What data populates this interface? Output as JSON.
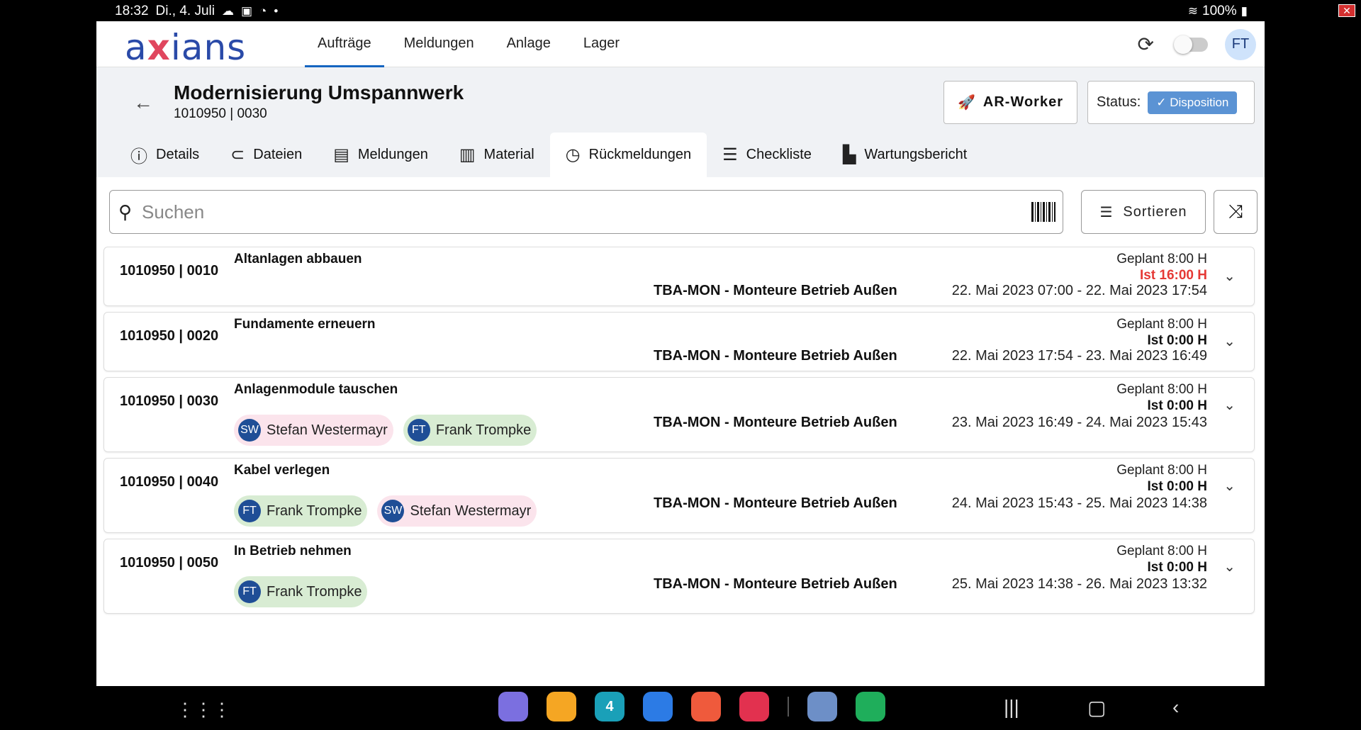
{
  "statusbar": {
    "time": "18:32",
    "date": "Di., 4. Juli",
    "battery": "100%"
  },
  "topbar": {
    "logo_prefix": "a",
    "logo_x": "x",
    "logo_suffix": "ians",
    "nav": [
      "Aufträge",
      "Meldungen",
      "Anlage",
      "Lager"
    ],
    "avatar": "FT"
  },
  "header": {
    "title": "Modernisierung Umspannwerk",
    "subtitle": "1010950 | 0030",
    "ar_button": "AR-Worker",
    "status_label": "Status:",
    "status_value": "Disposition"
  },
  "tabs": [
    {
      "label": "Details",
      "icon": "info-icon"
    },
    {
      "label": "Dateien",
      "icon": "paperclip-icon"
    },
    {
      "label": "Meldungen",
      "icon": "message-icon"
    },
    {
      "label": "Material",
      "icon": "factory-icon"
    },
    {
      "label": "Rückmeldungen",
      "icon": "clock-icon"
    },
    {
      "label": "Checkliste",
      "icon": "checklist-icon"
    },
    {
      "label": "Wartungsbericht",
      "icon": "document-icon"
    }
  ],
  "search": {
    "placeholder": "Suchen",
    "sort_label": "Sortieren"
  },
  "rows": [
    {
      "num": "1010950 | 0010",
      "name": "Altanlagen abbauen",
      "team": "TBA-MON - Monteure Betrieb Außen",
      "plan": "Geplant 8:00 H",
      "ist": "Ist 16:00 H",
      "range": "22. Mai 2023 07:00 - 22. Mai 2023 17:54"
    },
    {
      "num": "1010950 | 0020",
      "name": "Fundamente erneuern",
      "team": "TBA-MON - Monteure Betrieb Außen",
      "plan": "Geplant 8:00 H",
      "ist": "Ist 0:00 H",
      "range": "22. Mai 2023 17:54 - 23. Mai 2023 16:49"
    },
    {
      "num": "1010950 | 0030",
      "name": "Anlagenmodule tauschen",
      "team": "TBA-MON - Monteure Betrieb Außen",
      "plan": "Geplant 8:00 H",
      "ist": "Ist 0:00 H",
      "range": "23. Mai 2023 16:49 - 24. Mai 2023 15:43",
      "chips": [
        {
          "ini": "SW",
          "name": "Stefan Westermayr"
        },
        {
          "ini": "FT",
          "name": "Frank Trompke"
        }
      ]
    },
    {
      "num": "1010950 | 0040",
      "name": "Kabel verlegen",
      "team": "TBA-MON - Monteure Betrieb Außen",
      "plan": "Geplant 8:00 H",
      "ist": "Ist 0:00 H",
      "range": "24. Mai 2023 15:43 - 25. Mai 2023 14:38",
      "chips": [
        {
          "ini": "FT",
          "name": "Frank Trompke"
        },
        {
          "ini": "SW",
          "name": "Stefan Westermayr"
        }
      ]
    },
    {
      "num": "1010950 | 0050",
      "name": "In Betrieb nehmen",
      "team": "TBA-MON - Monteure Betrieb Außen",
      "plan": "Geplant 8:00 H",
      "ist": "Ist 0:00 H",
      "range": "25. Mai 2023 14:38 - 26. Mai 2023 13:32",
      "chips": [
        {
          "ini": "FT",
          "name": "Frank Trompke"
        }
      ]
    }
  ],
  "colors": {
    "accent": "#1565c0",
    "status_chip": "#5b93d4",
    "ist_over": "#e53935",
    "chip_sw": "#fbe4ec",
    "chip_ft": "#d8ecd3"
  },
  "dock_apps": [
    {
      "name": "internet-app-icon",
      "color": "#7b6fe0",
      "label": ""
    },
    {
      "name": "files-app-icon",
      "color": "#f5a623",
      "label": ""
    },
    {
      "name": "calendar-app-icon",
      "color": "#1aa0b8",
      "label": "4"
    },
    {
      "name": "messages-app-icon",
      "color": "#2c7be5",
      "label": ""
    },
    {
      "name": "contacts-app-icon",
      "color": "#ef5a3c",
      "label": ""
    },
    {
      "name": "screen-recorder-app-icon",
      "color": "#e2314f",
      "label": ""
    },
    {
      "name": "game-app-icon",
      "color": "#6d8fc7",
      "label": ""
    },
    {
      "name": "phone-app-icon",
      "color": "#1fae5b",
      "label": ""
    }
  ]
}
